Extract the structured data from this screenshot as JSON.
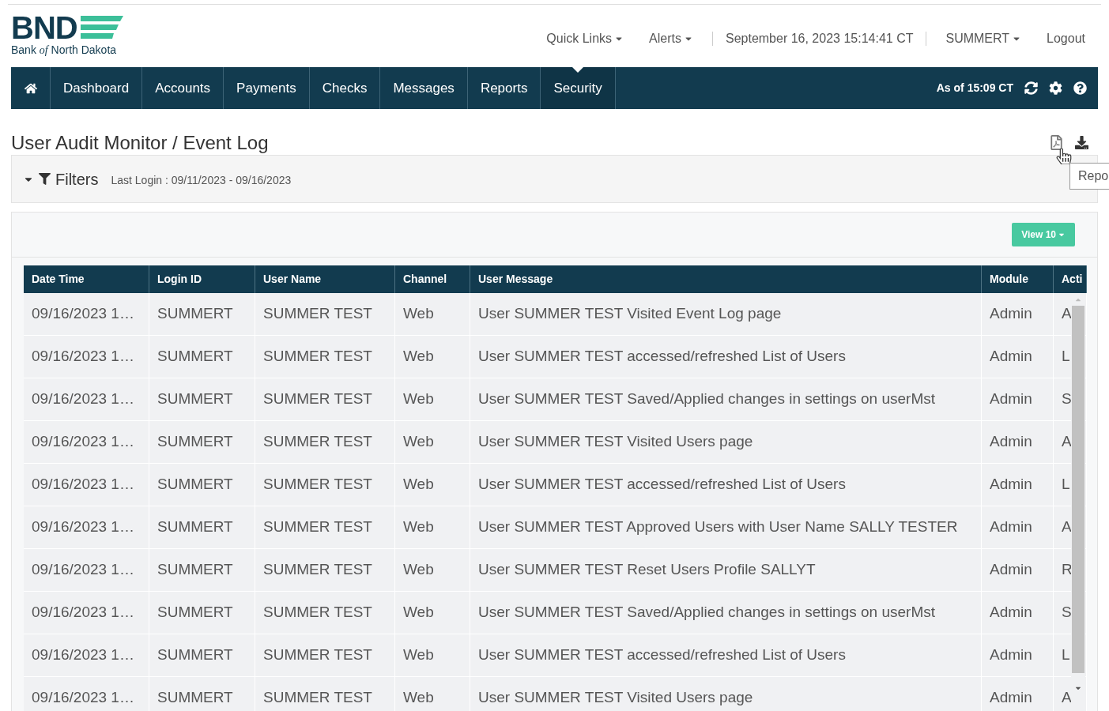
{
  "logo": {
    "mark": "BND",
    "subtitle_before": "Bank",
    "subtitle_of": "of",
    "subtitle_after": "North Dakota"
  },
  "top_links": [
    {
      "label": "Quick Links",
      "dropdown": true
    },
    {
      "label": "Alerts",
      "dropdown": true
    },
    {
      "label": "September 16, 2023 15:14:41 CT",
      "dropdown": false
    },
    {
      "label": "SUMMERT",
      "dropdown": true
    },
    {
      "label": "Logout",
      "dropdown": false
    }
  ],
  "nav": {
    "tabs": [
      {
        "label": "Dashboard",
        "selected": false
      },
      {
        "label": "Accounts",
        "selected": false
      },
      {
        "label": "Payments",
        "selected": false
      },
      {
        "label": "Checks",
        "selected": false
      },
      {
        "label": "Messages",
        "selected": false
      },
      {
        "label": "Reports",
        "selected": false
      },
      {
        "label": "Security",
        "selected": true
      }
    ],
    "as_of": "As of 15:09 CT"
  },
  "page_title": "User Audit Monitor / Event Log",
  "tooltip": "Repo",
  "filters": {
    "label": "Filters",
    "summary": "Last Login : 09/11/2023 - 09/16/2023",
    "expanded": true
  },
  "view_button": "View 10",
  "table": {
    "columns": [
      "Date Time",
      "Login ID",
      "User Name",
      "Channel",
      "User Message",
      "Module",
      "Acti"
    ],
    "rows": [
      [
        "09/16/2023 1…",
        "SUMMERT",
        "SUMMER TEST",
        "Web",
        "User SUMMER TEST Visited Event Log page",
        "Admin",
        "A"
      ],
      [
        "09/16/2023 1…",
        "SUMMERT",
        "SUMMER TEST",
        "Web",
        "User SUMMER TEST accessed/refreshed List of Users",
        "Admin",
        "L"
      ],
      [
        "09/16/2023 1…",
        "SUMMERT",
        "SUMMER TEST",
        "Web",
        "User SUMMER TEST Saved/Applied changes in settings on userMst",
        "Admin",
        "S"
      ],
      [
        "09/16/2023 1…",
        "SUMMERT",
        "SUMMER TEST",
        "Web",
        "User SUMMER TEST Visited Users page",
        "Admin",
        "A"
      ],
      [
        "09/16/2023 1…",
        "SUMMERT",
        "SUMMER TEST",
        "Web",
        "User SUMMER TEST accessed/refreshed List of Users",
        "Admin",
        "L"
      ],
      [
        "09/16/2023 1…",
        "SUMMERT",
        "SUMMER TEST",
        "Web",
        "User SUMMER TEST Approved Users with User Name SALLY TESTER",
        "Admin",
        "A"
      ],
      [
        "09/16/2023 1…",
        "SUMMERT",
        "SUMMER TEST",
        "Web",
        "User SUMMER TEST Reset Users Profile SALLYT",
        "Admin",
        "R"
      ],
      [
        "09/16/2023 1…",
        "SUMMERT",
        "SUMMER TEST",
        "Web",
        "User SUMMER TEST Saved/Applied changes in settings on userMst",
        "Admin",
        "S"
      ],
      [
        "09/16/2023 1…",
        "SUMMERT",
        "SUMMER TEST",
        "Web",
        "User SUMMER TEST accessed/refreshed List of Users",
        "Admin",
        "L"
      ],
      [
        "09/16/2023 1…",
        "SUMMERT",
        "SUMMER TEST",
        "Web",
        "User SUMMER TEST Visited Users page",
        "Admin",
        "A"
      ]
    ]
  }
}
